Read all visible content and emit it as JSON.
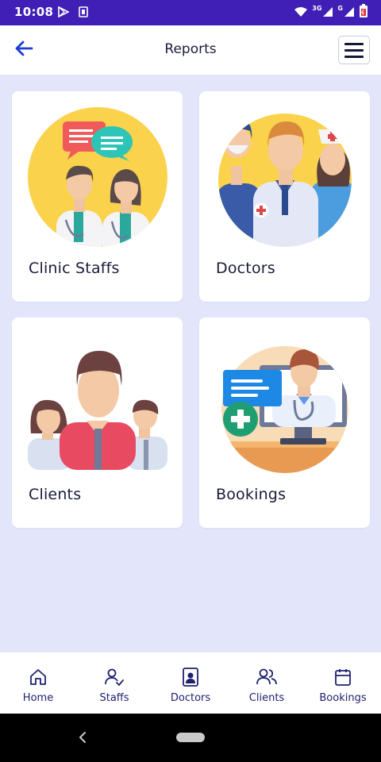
{
  "status_bar": {
    "time": "10:08",
    "network_label": "3G",
    "network_label2": "G",
    "icons": [
      "play-store-icon",
      "sim-icon",
      "wifi-icon",
      "signal-icon",
      "signal-icon",
      "battery-icon"
    ],
    "background": "#3f1fb6"
  },
  "app_bar": {
    "title": "Reports",
    "back_icon": "arrow-left-icon",
    "menu_icon": "hamburger-menu-icon",
    "accent": "#1f3bd6"
  },
  "cards": [
    {
      "label": "Clinic Staffs",
      "icon": "clinic-staff-illustration"
    },
    {
      "label": "Doctors",
      "icon": "doctors-illustration"
    },
    {
      "label": "Clients",
      "icon": "clients-illustration"
    },
    {
      "label": "Bookings",
      "icon": "bookings-illustration"
    }
  ],
  "bottom_nav": [
    {
      "label": "Home",
      "icon": "home-icon"
    },
    {
      "label": "Staffs",
      "icon": "user-check-icon"
    },
    {
      "label": "Doctors",
      "icon": "doctor-badge-icon"
    },
    {
      "label": "Clients",
      "icon": "users-icon"
    },
    {
      "label": "Bookings",
      "icon": "calendar-icon"
    }
  ],
  "colors": {
    "page_background": "#e3e6fb",
    "nav_text": "#1f2170"
  }
}
